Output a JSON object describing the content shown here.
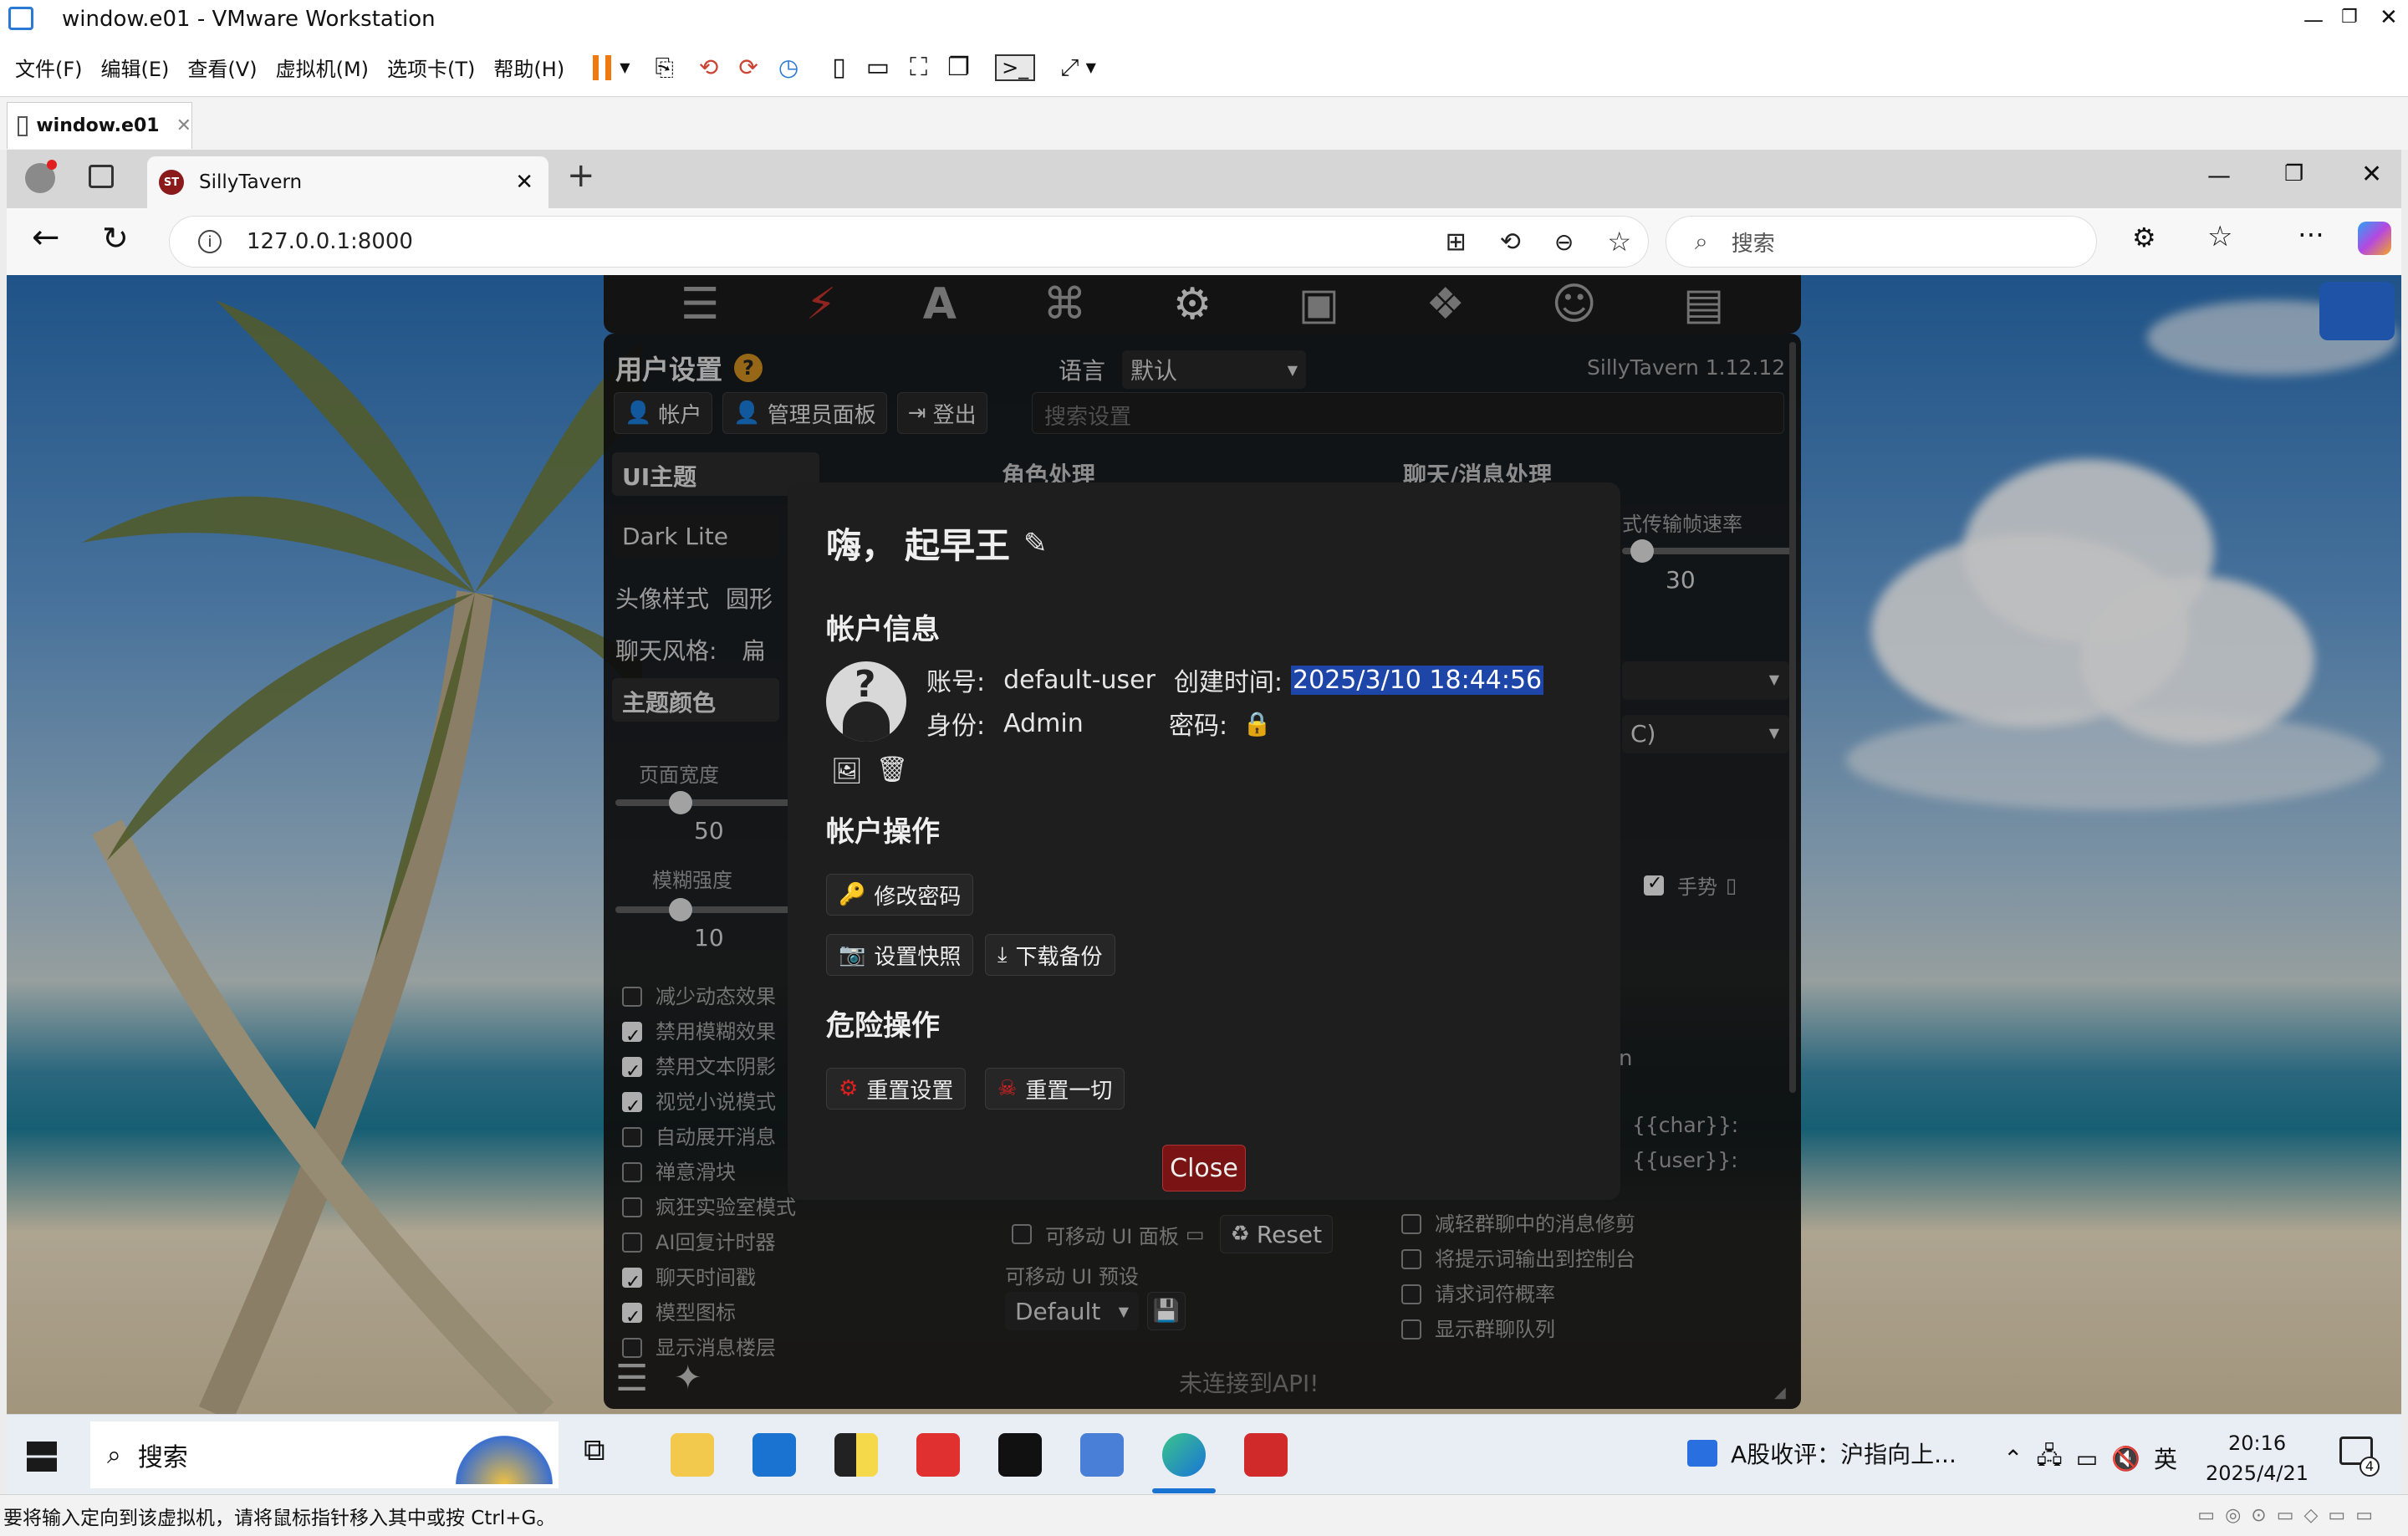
{
  "vmware": {
    "window_title": "window.e01 - VMware Workstation",
    "menu": [
      "文件(F)",
      "编辑(E)",
      "查看(V)",
      "虚拟机(M)",
      "选项卡(T)",
      "帮助(H)"
    ],
    "tab_label": "window.e01",
    "status_text": "要将输入定向到该虚拟机，请将鼠标指针移入其中或按 Ctrl+G。"
  },
  "browser": {
    "tab_title": "SillyTavern",
    "url": "127.0.0.1:8000",
    "search_placeholder": "搜索"
  },
  "st": {
    "panel_title": "用户设置",
    "lang_label": "语言",
    "lang_value": "默认",
    "version": "SillyTavern 1.12.12",
    "account_tab": "帐户",
    "admin_tab": "管理员面板",
    "logout_tab": "登出",
    "search_settings_placeholder": "搜索设置",
    "ui_theme_label": "UI主题",
    "char_handling": "角色处理",
    "chat_handling": "聊天/消息处理",
    "theme_value": "Dark Lite",
    "avatar_style_label": "头像样式",
    "avatar_style_value": "圆形",
    "chat_style_label": "聊天风格:",
    "chat_style_value": "扁",
    "theme_colors": "主题颜色",
    "page_width_label": "页面宽度",
    "page_width_value": "50",
    "blur_label": "模糊强度",
    "blur_value": "10",
    "stream_fps_label": "式传输帧速率",
    "stream_fps_value": "30",
    "select_c_value": "C)",
    "gesture_label": "手势",
    "n_text": "n",
    "char_macro": "{{char}}:",
    "user_macro": "{{user}}:",
    "checkboxes": [
      {
        "label": "减少动态效果",
        "on": false
      },
      {
        "label": "禁用模糊效果",
        "on": true
      },
      {
        "label": "禁用文本阴影",
        "on": true
      },
      {
        "label": "视觉小说模式",
        "on": true
      },
      {
        "label": "自动展开消息",
        "on": false
      },
      {
        "label": "禅意滑块",
        "on": false
      },
      {
        "label": "疯狂实验室模式",
        "on": false
      },
      {
        "label": "AI回复计时器",
        "on": false
      },
      {
        "label": "聊天时间戳",
        "on": true
      },
      {
        "label": "模型图标",
        "on": true
      },
      {
        "label": "显示消息楼层",
        "on": false
      }
    ],
    "movable_ui": "可移动 UI 面板",
    "reset_label": "Reset",
    "movable_preset_label": "可移动 UI 预设",
    "preset_value": "Default",
    "right_checks": [
      "减轻群聊中的消息修剪",
      "将提示词输出到控制台",
      "请求词符概率",
      "显示群聊队列"
    ],
    "api_status": "未连接到API!"
  },
  "modal": {
    "greeting": "嗨，",
    "username": "起早王",
    "account_info": "帐户信息",
    "account_label": "账号:",
    "account_value": "default-user",
    "created_label": "创建时间:",
    "created_value": "2025/3/10 18:44:56",
    "role_label": "身份:",
    "role_value": "Admin",
    "password_label": "密码:",
    "account_ops": "帐户操作",
    "change_password": "修改密码",
    "snapshot": "设置快照",
    "download_backup": "下载备份",
    "danger_ops": "危险操作",
    "reset_settings": "重置设置",
    "reset_all": "重置一切",
    "close": "Close"
  },
  "taskbar": {
    "search": "搜索",
    "news": "A股收评：沪指向上...",
    "ime": "英",
    "time": "20:16",
    "date": "2025/4/21",
    "notif_count": "4"
  },
  "colors": {
    "accent_red": "#8b1a1a",
    "highlight": "#1e46a8",
    "st_bg": "#1e1e1e"
  }
}
